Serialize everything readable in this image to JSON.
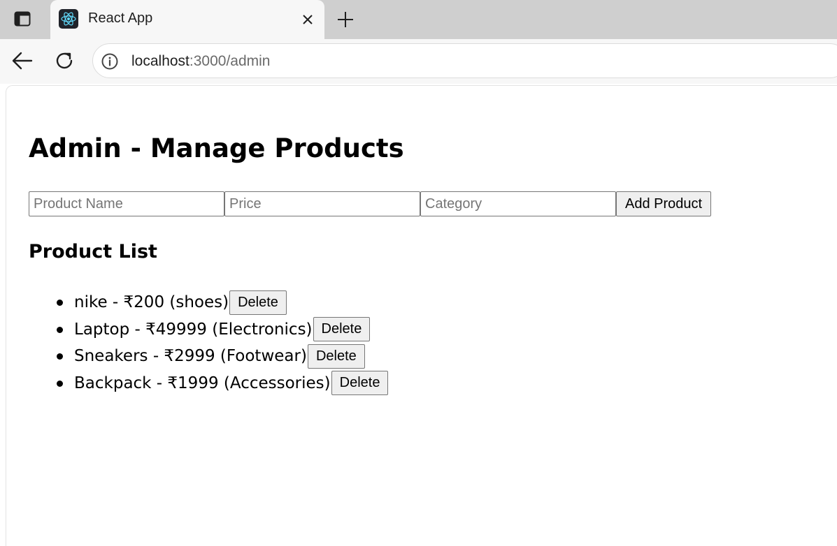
{
  "browser": {
    "tab": {
      "title": "React App",
      "favicon": "react-icon"
    },
    "address": {
      "host": "localhost",
      "path": ":3000/admin"
    }
  },
  "page": {
    "title": "Admin - Manage Products",
    "form": {
      "name_placeholder": "Product Name",
      "price_placeholder": "Price",
      "category_placeholder": "Category",
      "add_label": "Add Product"
    },
    "list_title": "Product List",
    "products": [
      {
        "text": "nike - ₹200 (shoes)",
        "delete_label": "Delete"
      },
      {
        "text": "Laptop - ₹49999 (Electronics)",
        "delete_label": "Delete"
      },
      {
        "text": "Sneakers - ₹2999 (Footwear)",
        "delete_label": "Delete"
      },
      {
        "text": "Backpack - ₹1999 (Accessories)",
        "delete_label": "Delete"
      }
    ]
  }
}
